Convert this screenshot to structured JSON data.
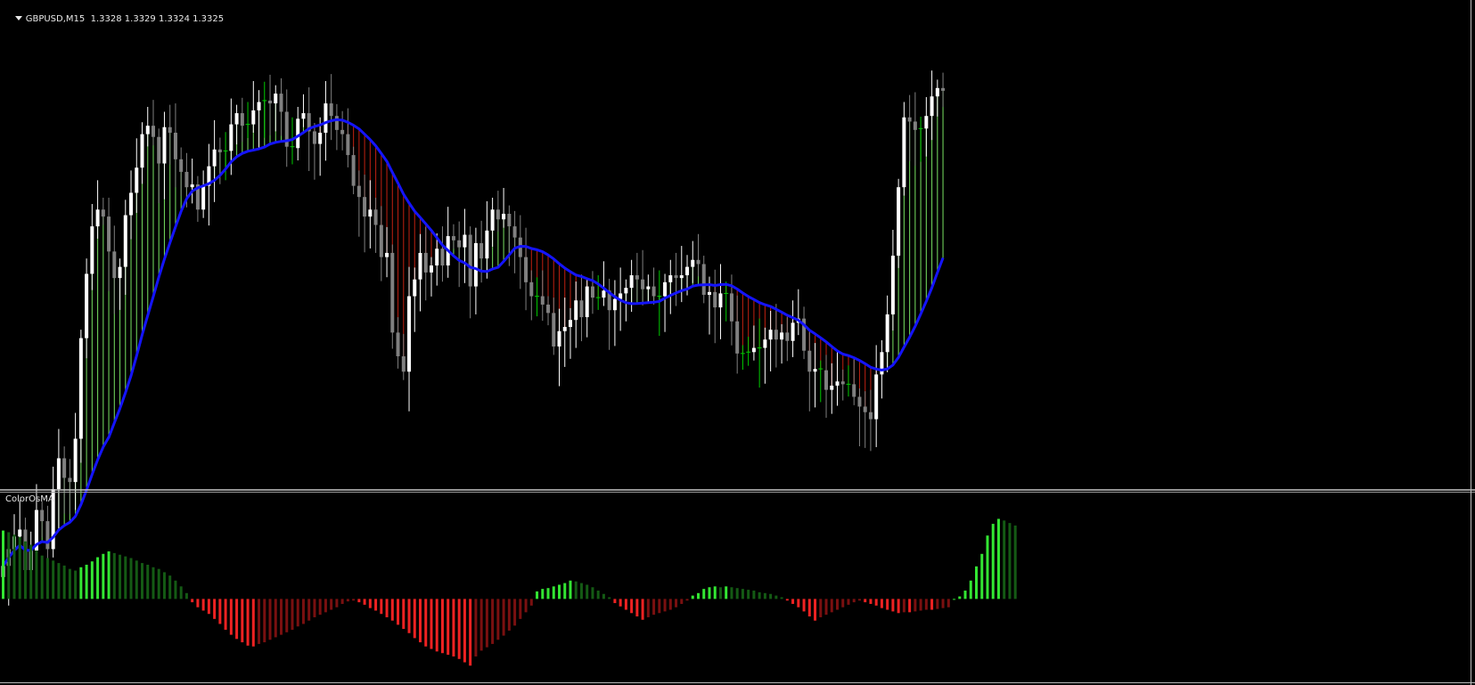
{
  "header": {
    "symbol": "GBPUSD,M15",
    "quote": "1.3328 1.3329 1.3324 1.3325"
  },
  "indicator": {
    "name": "ColorOsMA"
  },
  "colors": {
    "background": "#000000",
    "bull_candle": "#ffffff",
    "bear_candle": "#808080",
    "doji": "#00cc00",
    "ma_line": "#1414ff",
    "hist_up": "#6ecf5a",
    "hist_down": "#b01e10",
    "osma_up_strong": "#33e633",
    "osma_up_weak": "#145a14",
    "osma_down_strong": "#ee2222",
    "osma_down_weak": "#7a1010"
  },
  "chart_data": [
    {
      "type": "candlestick",
      "title": "GBPUSD,M15",
      "series": [
        {
          "name": "price_close",
          "values": [
            1.2985,
            1.2997,
            1.3006,
            1.3011,
            1.2982,
            1.2996,
            1.3025,
            1.3017,
            1.2997,
            1.304,
            1.3062,
            1.3048,
            1.3045,
            1.3076,
            1.3148,
            1.3194,
            1.3228,
            1.324,
            1.3235,
            1.321,
            1.3191,
            1.3199,
            1.3236,
            1.3252,
            1.327,
            1.3294,
            1.33,
            1.3292,
            1.3273,
            1.3299,
            1.3295,
            1.3276,
            1.3267,
            1.3256,
            1.3258,
            1.324,
            1.3257,
            1.3271,
            1.3283,
            1.3281,
            1.3282,
            1.3301,
            1.3309,
            1.33,
            1.3301,
            1.3311,
            1.3317,
            1.3318,
            1.3316,
            1.3323,
            1.331,
            1.3285,
            1.3284,
            1.3305,
            1.3309,
            1.3296,
            1.3287,
            1.3295,
            1.3316,
            1.3307,
            1.3297,
            1.3294,
            1.3279,
            1.3257,
            1.3249,
            1.3235,
            1.324,
            1.3229,
            1.3206,
            1.3209,
            1.3152,
            1.3135,
            1.3124,
            1.3178,
            1.319,
            1.3209,
            1.3195,
            1.32,
            1.3212,
            1.32,
            1.3221,
            1.3218,
            1.3213,
            1.3222,
            1.3185,
            1.3216,
            1.3205,
            1.3225,
            1.324,
            1.3233,
            1.3237,
            1.3228,
            1.322,
            1.3206,
            1.3188,
            1.3178,
            1.3178,
            1.3172,
            1.3166,
            1.3142,
            1.3153,
            1.3156,
            1.3161,
            1.3175,
            1.3163,
            1.3185,
            1.3177,
            1.3177,
            1.3182,
            1.3168,
            1.3176,
            1.318,
            1.3184,
            1.3193,
            1.319,
            1.3183,
            1.3185,
            1.3178,
            1.3178,
            1.3188,
            1.3193,
            1.3191,
            1.3193,
            1.3199,
            1.3204,
            1.3201,
            1.3179,
            1.3181,
            1.317,
            1.318,
            1.318,
            1.316,
            1.3137,
            1.3137,
            1.3138,
            1.3141,
            1.3141,
            1.3147,
            1.3154,
            1.3147,
            1.3152,
            1.3146,
            1.3159,
            1.3162,
            1.3139,
            1.3124,
            1.3126,
            1.3125,
            1.3111,
            1.3114,
            1.3117,
            1.3115,
            1.3115,
            1.3106,
            1.3099,
            1.3095,
            1.309,
            1.3122,
            1.3138,
            1.3165,
            1.3207,
            1.3256,
            1.3306,
            1.3303,
            1.3297,
            1.3298,
            1.3307,
            1.3321,
            1.3327,
            1.3325
          ]
        }
      ],
      "ylim": [
        1.304,
        1.339
      ],
      "overlay": {
        "type": "line",
        "name": "MA"
      },
      "grid": false,
      "legend": "none"
    },
    {
      "type": "bar",
      "title": "ColorOsMA",
      "series": [
        {
          "name": "osma",
          "values": [
            0.82,
            0.8,
            0.77,
            0.74,
            0.69,
            0.65,
            0.58,
            0.52,
            0.49,
            0.46,
            0.43,
            0.4,
            0.36,
            0.34,
            0.38,
            0.41,
            0.45,
            0.5,
            0.54,
            0.57,
            0.55,
            0.53,
            0.51,
            0.49,
            0.46,
            0.43,
            0.41,
            0.38,
            0.36,
            0.32,
            0.28,
            0.22,
            0.15,
            0.07,
            -0.04,
            -0.1,
            -0.14,
            -0.18,
            -0.24,
            -0.3,
            -0.37,
            -0.43,
            -0.48,
            -0.52,
            -0.56,
            -0.57,
            -0.54,
            -0.52,
            -0.49,
            -0.46,
            -0.43,
            -0.4,
            -0.37,
            -0.33,
            -0.3,
            -0.26,
            -0.22,
            -0.19,
            -0.16,
            -0.13,
            -0.1,
            -0.06,
            -0.03,
            -0.02,
            -0.04,
            -0.07,
            -0.11,
            -0.14,
            -0.18,
            -0.22,
            -0.26,
            -0.31,
            -0.36,
            -0.41,
            -0.47,
            -0.52,
            -0.57,
            -0.6,
            -0.63,
            -0.65,
            -0.67,
            -0.69,
            -0.72,
            -0.76,
            -0.8,
            -0.69,
            -0.62,
            -0.58,
            -0.54,
            -0.49,
            -0.44,
            -0.38,
            -0.32,
            -0.24,
            -0.16,
            -0.08,
            0.09,
            0.12,
            0.13,
            0.15,
            0.17,
            0.19,
            0.22,
            0.21,
            0.19,
            0.17,
            0.14,
            0.1,
            0.06,
            0.02,
            -0.05,
            -0.09,
            -0.13,
            -0.17,
            -0.21,
            -0.25,
            -0.22,
            -0.19,
            -0.17,
            -0.15,
            -0.13,
            -0.1,
            -0.06,
            -0.02,
            0.04,
            0.07,
            0.12,
            0.14,
            0.15,
            0.14,
            0.15,
            0.14,
            0.13,
            0.12,
            0.11,
            0.1,
            0.08,
            0.07,
            0.06,
            0.04,
            0.02,
            -0.02,
            -0.06,
            -0.1,
            -0.15,
            -0.21,
            -0.26,
            -0.22,
            -0.19,
            -0.16,
            -0.13,
            -0.1,
            -0.07,
            -0.04,
            -0.02,
            -0.04,
            -0.06,
            -0.08,
            -0.11,
            -0.13,
            -0.15,
            -0.17,
            -0.16,
            -0.16,
            -0.15,
            -0.14,
            -0.13,
            -0.13,
            -0.12,
            -0.11,
            -0.1,
            0.0,
            0.03,
            0.1,
            0.22,
            0.39,
            0.54,
            0.76,
            0.9,
            0.96,
            0.94,
            0.91,
            0.88
          ]
        }
      ],
      "ylim": [
        -1.0,
        1.2
      ],
      "grid": false,
      "legend": "none"
    }
  ]
}
